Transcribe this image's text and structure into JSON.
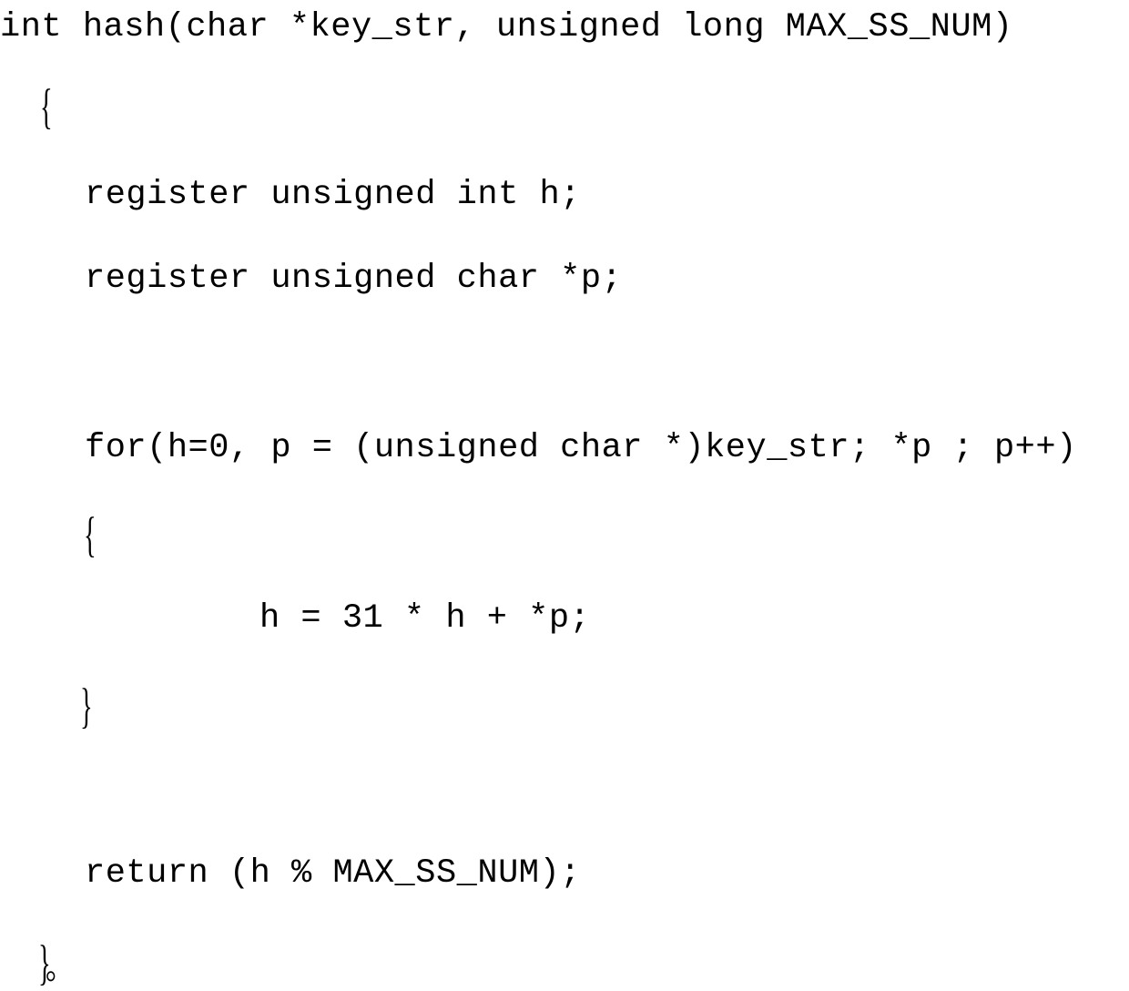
{
  "document": {
    "kind": "code-listing",
    "language": "C",
    "text_color": "#000000",
    "background_color": "#ffffff",
    "trailing_punctuation": "。"
  },
  "code": {
    "lines": [
      {
        "id": "signature",
        "text": "int hash(char *key_str, unsigned long MAX_SS_NUM)"
      },
      {
        "id": "open_outer",
        "text": "{"
      },
      {
        "id": "decl_h",
        "text": "register unsigned int h;"
      },
      {
        "id": "decl_p",
        "text": "register unsigned char *p;"
      },
      {
        "id": "for_stmt",
        "text": "for(h=0, p = (unsigned char *)key_str; *p ; p++)"
      },
      {
        "id": "open_inner",
        "text": "{"
      },
      {
        "id": "body_hash",
        "text": "h = 31 * h + *p;"
      },
      {
        "id": "close_inner",
        "text": "}"
      },
      {
        "id": "return_stmt",
        "text": "return (h % MAX_SS_NUM);"
      },
      {
        "id": "close_outer",
        "text": "}"
      }
    ],
    "full_source": "int hash(char *key_str, unsigned long MAX_SS_NUM)\n  {\n    register unsigned int h;\n    register unsigned char *p;\n\n    for(h=0, p = (unsigned char *)key_str; *p ; p++)\n    {\n        h = 31 * h + *p;\n    }\n\n    return (h % MAX_SS_NUM);\n  }。"
  }
}
